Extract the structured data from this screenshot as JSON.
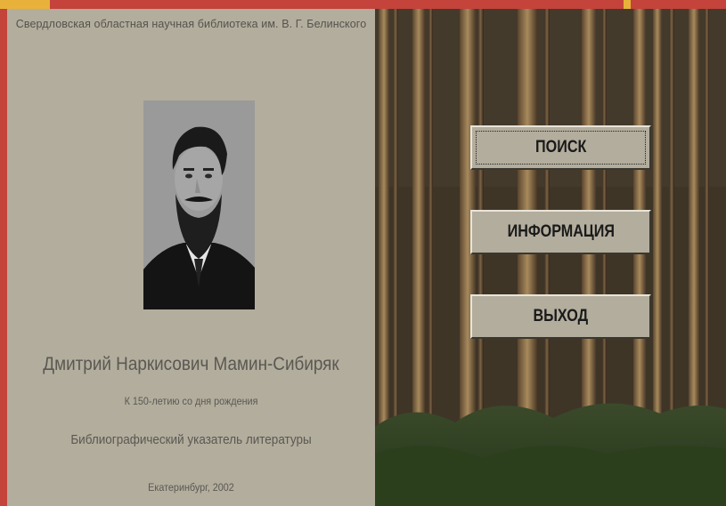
{
  "header": {
    "library_name": "Свердловская областная научная библиотека им. В. Г. Белинского"
  },
  "title_panel": {
    "author": "Дмитрий Наркисович Мамин-Сибиряк",
    "anniversary": "К 150-летию со дня рождения",
    "subtitle": "Библиографический указатель литературы",
    "place_year": "Екатеринбург, 2002"
  },
  "menu": {
    "search_label": "ПОИСК",
    "info_label": "ИНФОРМАЦИЯ",
    "exit_label": "ВЫХОД"
  },
  "colors": {
    "frame": "#c4433b",
    "panel": "#b3ad9d",
    "accent": "#e8b23a"
  }
}
